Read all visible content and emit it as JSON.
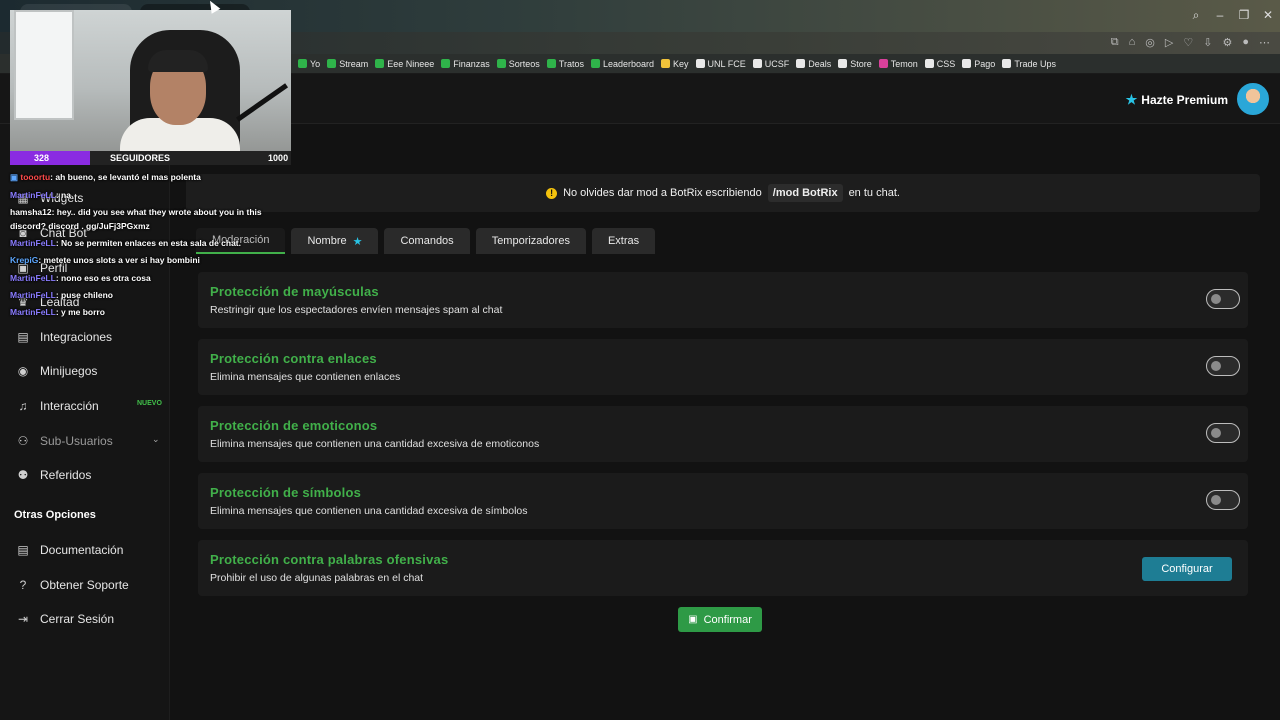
{
  "browser": {
    "bookmarks": [
      "Yo",
      "Stream",
      "Eee Nineee",
      "Finanzas",
      "Sorteos",
      "Tratos",
      "Leaderboard",
      "Key",
      "UNL FCE",
      "UCSF",
      "Deals",
      "Store",
      "Temon",
      "CSS",
      "Pago",
      "Trade Ups"
    ]
  },
  "header": {
    "premium_label": "Hazte Premium"
  },
  "sidebar": {
    "items": [
      {
        "label": "Widgets",
        "icon": "widgets-icon"
      },
      {
        "label": "Chat Bot",
        "icon": "chatbot-icon"
      },
      {
        "label": "Perfil",
        "icon": "profile-icon"
      },
      {
        "label": "Lealtad",
        "icon": "loyalty-icon"
      },
      {
        "label": "Integraciones",
        "icon": "integrations-icon"
      },
      {
        "label": "Minijuegos",
        "icon": "gamepad-icon"
      },
      {
        "label": "Interacción",
        "icon": "music-icon",
        "badge": "NUEVO"
      },
      {
        "label": "Sub-Usuarios",
        "icon": "users-icon"
      },
      {
        "label": "Referidos",
        "icon": "referrals-icon"
      }
    ],
    "section_title": "Otras Opciones",
    "other_items": [
      {
        "label": "Documentación",
        "icon": "docs-icon"
      },
      {
        "label": "Obtener Soporte",
        "icon": "question-icon"
      },
      {
        "label": "Cerrar Sesión",
        "icon": "logout-icon"
      }
    ]
  },
  "notice": {
    "prefix": "No olvides dar mod a BotRix escribiendo",
    "command": "/mod BotRix",
    "suffix": "en tu chat."
  },
  "tabs": [
    "Moderación",
    "Nombre",
    "Comandos",
    "Temporizadores",
    "Extras"
  ],
  "protections": [
    {
      "title": "Protección de mayúsculas",
      "desc": "Restringir que los espectadores envíen mensajes spam al chat",
      "enabled": false
    },
    {
      "title": "Protección contra enlaces",
      "desc": "Elimina mensajes que contienen enlaces",
      "enabled": false
    },
    {
      "title": "Protección de emoticonos",
      "desc": "Elimina mensajes que contienen una cantidad excesiva de emoticonos",
      "enabled": false
    },
    {
      "title": "Protección de símbolos",
      "desc": "Elimina mensajes que contienen una cantidad excesiva de símbolos",
      "enabled": false
    },
    {
      "title": "Protección contra palabras ofensivas",
      "desc": "Prohibir el uso de algunas palabras en el chat",
      "action": "Configurar"
    }
  ],
  "confirm_label": "Confirmar",
  "overlay": {
    "followers_current": "328",
    "followers_label": "SEGUIDORES",
    "followers_goal": "1000",
    "chat": [
      {
        "user": "tooortu",
        "text": ": ah bueno, se levantó el mas polenta"
      },
      {
        "user": "MartinFeLL",
        "text": ": na"
      },
      {
        "user": "hamsha12",
        "text": ": hey.. did you see what they wrote about you in this"
      },
      {
        "user": "",
        "text": "discord? discord . gg/JuFj3PGxmz"
      },
      {
        "user": "MartinFeLL",
        "text": ": No se permiten enlaces en esta sala de chat."
      },
      {
        "user": "KrepiG",
        "text": ": metete unos slots a ver si hay bombini"
      },
      {
        "user": "MartinFeLL",
        "text": ": nono eso es otra cosa"
      },
      {
        "user": "MartinFeLL",
        "text": ": puse chileno"
      },
      {
        "user": "MartinFeLL",
        "text": ": y me borro"
      }
    ]
  }
}
